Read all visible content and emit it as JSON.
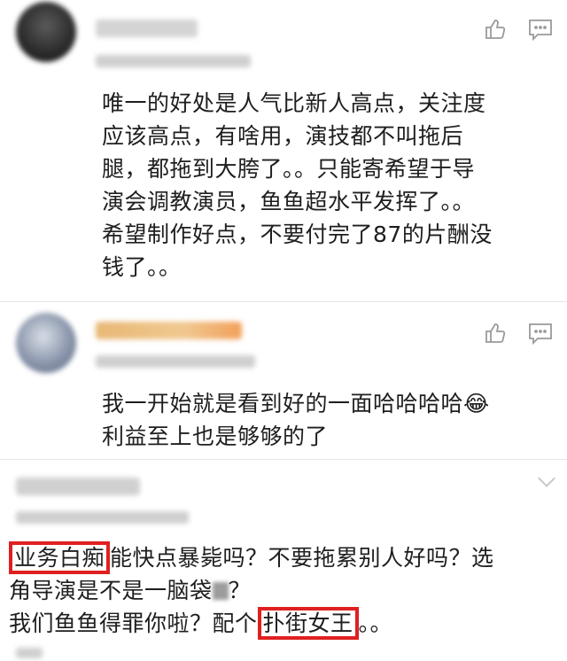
{
  "comments": [
    {
      "text_lines": [
        "唯一的好处是人气比新人高点，关注度",
        "应该高点，有啥用，演技都不叫拖后",
        "腿，都拖到大胯了。。只能寄希望于导",
        "演会调教演员，鱼鱼超水平发挥了。。",
        "希望制作好点，不要付完了87的片酬没",
        "钱了。。"
      ]
    },
    {
      "text_lines": [
        "我一开始就是看到好的一面哈哈哈哈😂",
        "利益至上也是够够的了"
      ]
    },
    {
      "highlight_1": "业务白痴",
      "line1_rest": "能快点暴毙吗？不要拖累别人好吗？选",
      "line2": "角导演是不是一脑袋",
      "line2_end": "？",
      "line3_start": "我们鱼鱼得罪你啦？配个",
      "highlight_2": "扑街女王",
      "line3_end": "。。"
    }
  ],
  "colors": {
    "highlight_border": "#e02020",
    "icon_gray": "#9a9a9a"
  }
}
